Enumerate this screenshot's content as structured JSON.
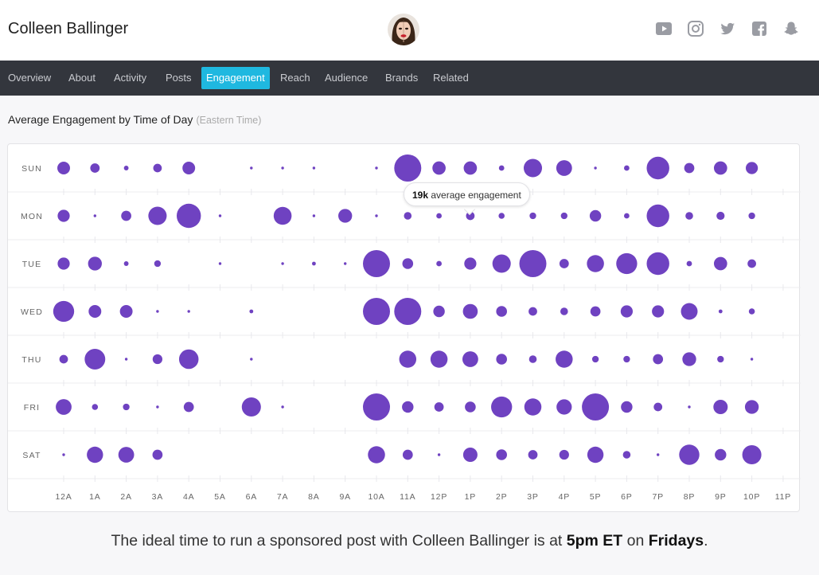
{
  "header": {
    "profile_name": "Colleen Ballinger",
    "social_icons": [
      "youtube-icon",
      "instagram-icon",
      "twitter-icon",
      "facebook-icon",
      "snapchat-icon"
    ],
    "icon_color": "#9a9ca3"
  },
  "nav": {
    "items": [
      "Overview",
      "About",
      "Activity",
      "Posts",
      "Engagement",
      "Reach",
      "Audience",
      "Brands",
      "Related"
    ],
    "active": "Engagement",
    "active_color": "#1fb8e0"
  },
  "section": {
    "title": "Average Engagement by Time of Day",
    "subtitle": "(Eastern Time)"
  },
  "tooltip": {
    "value": "19k",
    "label": "average engagement"
  },
  "summary": {
    "prefix": "The ideal time to run a sponsored post with Colleen Ballinger is at ",
    "time": "5pm ET",
    "middle": " on ",
    "day": "Fridays",
    "suffix": "."
  },
  "chart_data": {
    "type": "bubble-heatmap",
    "title": "Average Engagement by Time of Day",
    "rows": [
      "SUN",
      "MON",
      "TUE",
      "WED",
      "THU",
      "FRI",
      "SAT"
    ],
    "columns": [
      "12A",
      "1A",
      "2A",
      "3A",
      "4A",
      "5A",
      "6A",
      "7A",
      "8A",
      "9A",
      "10A",
      "11A",
      "12P",
      "1P",
      "2P",
      "3P",
      "4P",
      "5P",
      "6P",
      "7P",
      "8P",
      "9P",
      "10P",
      "11P"
    ],
    "bubble_color": "#6f42c1",
    "value_scale": "relative engagement (0-100)",
    "values": [
      [
        22,
        12,
        3,
        10,
        22,
        0,
        1,
        1,
        1,
        0,
        1,
        100,
        24,
        24,
        4,
        46,
        34,
        1,
        4,
        70,
        14,
        24,
        20,
        0
      ],
      [
        20,
        1,
        14,
        46,
        80,
        1,
        0,
        44,
        1,
        26,
        1,
        8,
        4,
        10,
        5,
        6,
        6,
        18,
        4,
        70,
        8,
        9,
        6,
        0
      ],
      [
        20,
        26,
        3,
        6,
        0,
        1,
        0,
        1,
        2,
        1,
        100,
        16,
        4,
        20,
        46,
        100,
        12,
        40,
        60,
        70,
        4,
        24,
        10,
        0
      ],
      [
        60,
        22,
        22,
        1,
        1,
        0,
        2,
        0,
        0,
        0,
        100,
        100,
        18,
        30,
        16,
        10,
        8,
        14,
        20,
        20,
        38,
        2,
        5,
        0
      ],
      [
        10,
        58,
        1,
        13,
        52,
        0,
        1,
        0,
        0,
        0,
        0,
        40,
        40,
        34,
        16,
        8,
        40,
        6,
        6,
        14,
        26,
        6,
        1,
        0
      ],
      [
        34,
        5,
        6,
        1,
        14,
        0,
        50,
        1,
        0,
        0,
        100,
        18,
        12,
        16,
        60,
        40,
        32,
        100,
        18,
        10,
        1,
        28,
        26,
        0
      ],
      [
        1,
        36,
        34,
        14,
        0,
        0,
        0,
        0,
        0,
        0,
        40,
        14,
        1,
        28,
        16,
        12,
        13,
        36,
        8,
        1,
        56,
        18,
        50,
        0
      ]
    ]
  }
}
